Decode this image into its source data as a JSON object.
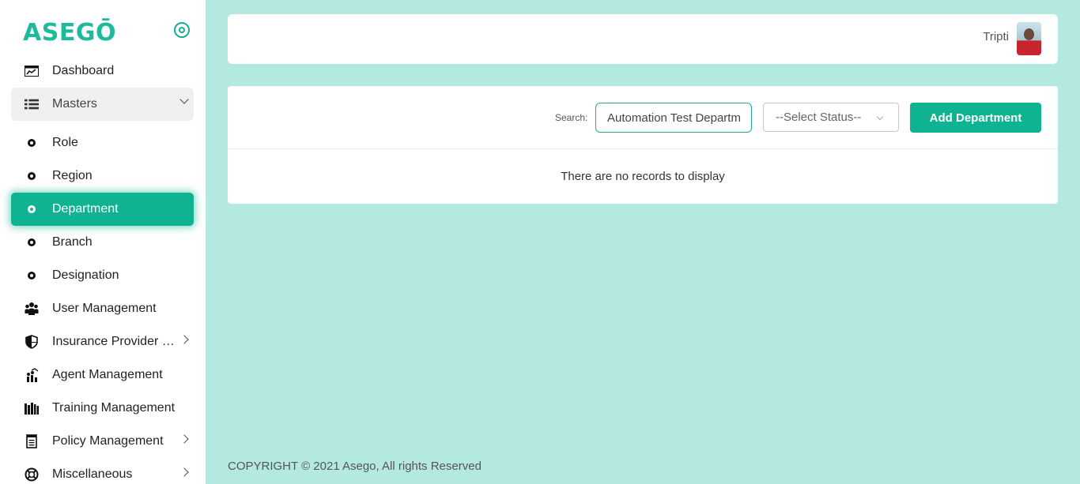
{
  "brand": {
    "logo": "ASEGŌ",
    "accent": "#0fb291"
  },
  "sidebar": {
    "items": [
      {
        "label": "Dashboard",
        "icon": "dashboard-icon"
      },
      {
        "label": "Masters",
        "icon": "list-icon"
      },
      {
        "label": "Role",
        "icon": "bullet-icon"
      },
      {
        "label": "Region",
        "icon": "bullet-icon"
      },
      {
        "label": "Department",
        "icon": "bullet-icon"
      },
      {
        "label": "Branch",
        "icon": "bullet-icon"
      },
      {
        "label": "Designation",
        "icon": "bullet-icon"
      },
      {
        "label": "User Management",
        "icon": "users-icon"
      },
      {
        "label": "Insurance Provider Management",
        "icon": "shield-icon"
      },
      {
        "label": "Agent Management",
        "icon": "agent-icon"
      },
      {
        "label": "Training Management",
        "icon": "books-icon"
      },
      {
        "label": "Policy Management",
        "icon": "document-icon"
      },
      {
        "label": "Miscellaneous",
        "icon": "lifebuoy-icon"
      }
    ]
  },
  "header": {
    "user_name": "Tripti"
  },
  "toolbar": {
    "search_label": "Search:",
    "search_value": "Automation Test Department",
    "status_placeholder": "--Select Status--",
    "add_button": "Add Department"
  },
  "table": {
    "empty_message": "There are no records to display"
  },
  "footer": {
    "copyright": "COPYRIGHT © 2021 Asego, All rights Reserved"
  }
}
